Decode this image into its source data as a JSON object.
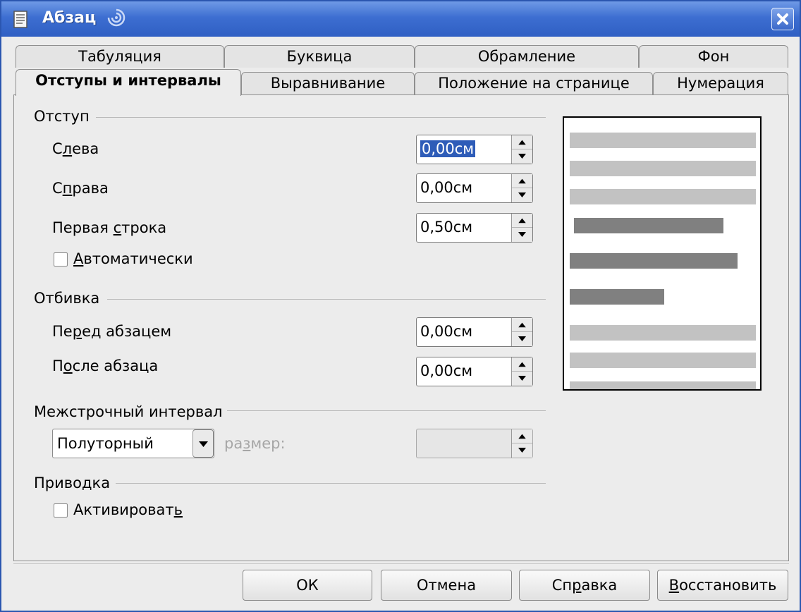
{
  "window": {
    "title": "Абзац"
  },
  "tabs": {
    "back_row": [
      "Табуляция",
      "Буквица",
      "Обрамление",
      "Фон"
    ],
    "front_row": [
      "Отступы и интервалы",
      "Выравнивание",
      "Положение на странице",
      "Нумерация"
    ],
    "active": "Отступы и интервалы"
  },
  "indent": {
    "heading": "Отступ",
    "left_label": [
      "С",
      "л",
      "ева"
    ],
    "left_value": "0,00см",
    "right_label": [
      "С",
      "п",
      "рава"
    ],
    "right_value": "0,00см",
    "first_label": [
      "Первая ",
      "с",
      "трока"
    ],
    "first_value": "0,50см",
    "auto_label": [
      "А",
      "втоматически"
    ],
    "auto_checked": false
  },
  "spacing": {
    "heading": "Отбивка",
    "before_label": [
      "Пе",
      "р",
      "ед абзацем"
    ],
    "before_value": "0,00см",
    "after_label": [
      "П",
      "о",
      "сле абзаца"
    ],
    "after_value": "0,00см"
  },
  "line_spacing": {
    "heading": "Межстрочный интервал",
    "selected": "Полуторный",
    "size_label": [
      "ра",
      "з",
      "мер:"
    ],
    "size_value": ""
  },
  "register": {
    "heading": "Приводка",
    "activate_label": [
      "Активироват",
      "ь"
    ],
    "activate_checked": false
  },
  "buttons": {
    "ok": "ОК",
    "cancel": "Отмена",
    "help": [
      "Сп",
      "р",
      "авка"
    ],
    "reset": [
      "В",
      "осстановить"
    ]
  },
  "colors": {
    "title_bar": "#3d6ed1",
    "selection": "#2e5cb8",
    "preview_light": "#c2c2c2",
    "preview_dark": "#808080"
  }
}
